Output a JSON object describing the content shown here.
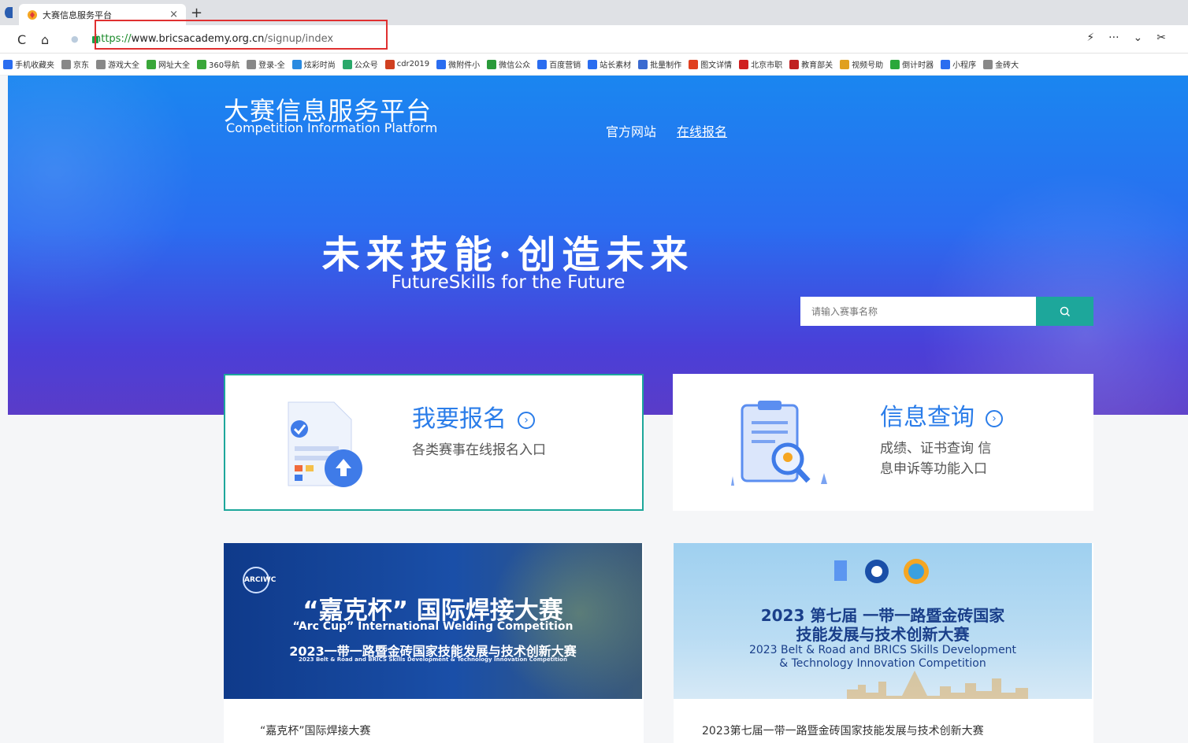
{
  "browser": {
    "tab_title": "大赛信息服务平台",
    "tab_close": "×",
    "new_tab": "+",
    "url_scheme": "https://",
    "url_host": "www.bricsacademy.org.cn",
    "url_path": "/signup/index",
    "tools": [
      "⚡",
      "···",
      "⌄",
      "✂"
    ]
  },
  "bookmarks": [
    {
      "label": "手机收藏夹",
      "color": "#2a6df0"
    },
    {
      "label": "京东",
      "color": "#888"
    },
    {
      "label": "游戏大全",
      "color": "#888"
    },
    {
      "label": "网址大全",
      "color": "#3aa73a"
    },
    {
      "label": "360导航",
      "color": "#3aa73a"
    },
    {
      "label": "登录-全",
      "color": "#888"
    },
    {
      "label": "炫彩时尚",
      "color": "#2a8ae0"
    },
    {
      "label": "公众号",
      "color": "#2aa86a"
    },
    {
      "label": "cdr2019",
      "color": "#d04020"
    },
    {
      "label": "微附件小",
      "color": "#2a6df0"
    },
    {
      "label": "微信公众",
      "color": "#2a9a3a"
    },
    {
      "label": "百度营销",
      "color": "#2a6df0"
    },
    {
      "label": "站长素材",
      "color": "#2a6df0"
    },
    {
      "label": "批量制作",
      "color": "#3a6ad0"
    },
    {
      "label": "图文详情",
      "color": "#e04020"
    },
    {
      "label": "北京市职",
      "color": "#d02020"
    },
    {
      "label": "教育部关",
      "color": "#c02020"
    },
    {
      "label": "视频号助",
      "color": "#e0a020"
    },
    {
      "label": "倒计时器",
      "color": "#2aa83a"
    },
    {
      "label": "小程序",
      "color": "#2a6df0"
    },
    {
      "label": "金砖大",
      "color": "#888"
    }
  ],
  "header": {
    "logo_cn": "大赛信息服务平台",
    "logo_en": "Competition Information Platform",
    "nav": [
      "官方网站",
      "在线报名"
    ]
  },
  "hero": {
    "slogan_cn": "未来技能·创造未来",
    "slogan_en": "FutureSkills  for the Future",
    "search_placeholder": "请输入赛事名称"
  },
  "cards": [
    {
      "title": "我要报名",
      "desc": "各类赛事在线报名入口"
    },
    {
      "title": "信息查询",
      "desc_line1": "成绩、证书查询 信",
      "desc_line2": "息申诉等功能入口"
    }
  ],
  "banners": [
    {
      "badge": "ARCIWC",
      "headline": "“嘉克杯” 国际焊接大赛",
      "sub_en": "“Arc Cup” International Welding Competition",
      "line2": "2023一带一路暨金砖国家技能发展与技术创新大赛",
      "line3": "2023 Belt & Road and BRICS Skills Development & Technology Innovation Competition",
      "caption": "“嘉克杯”国际焊接大赛"
    },
    {
      "headline1": "2023 第七届 一带一路暨金砖国家",
      "headline2": "技能发展与技术创新大赛",
      "en1": "2023 Belt & Road and BRICS Skills Development",
      "en2": "& Technology Innovation Competition",
      "caption": "2023第七届一带一路暨金砖国家技能发展与技术创新大赛"
    }
  ],
  "colors": {
    "accent": "#1da79b",
    "link_blue": "#2b7de9",
    "hero_top": "#1a86f0",
    "hero_bottom": "#5a3cc8"
  }
}
